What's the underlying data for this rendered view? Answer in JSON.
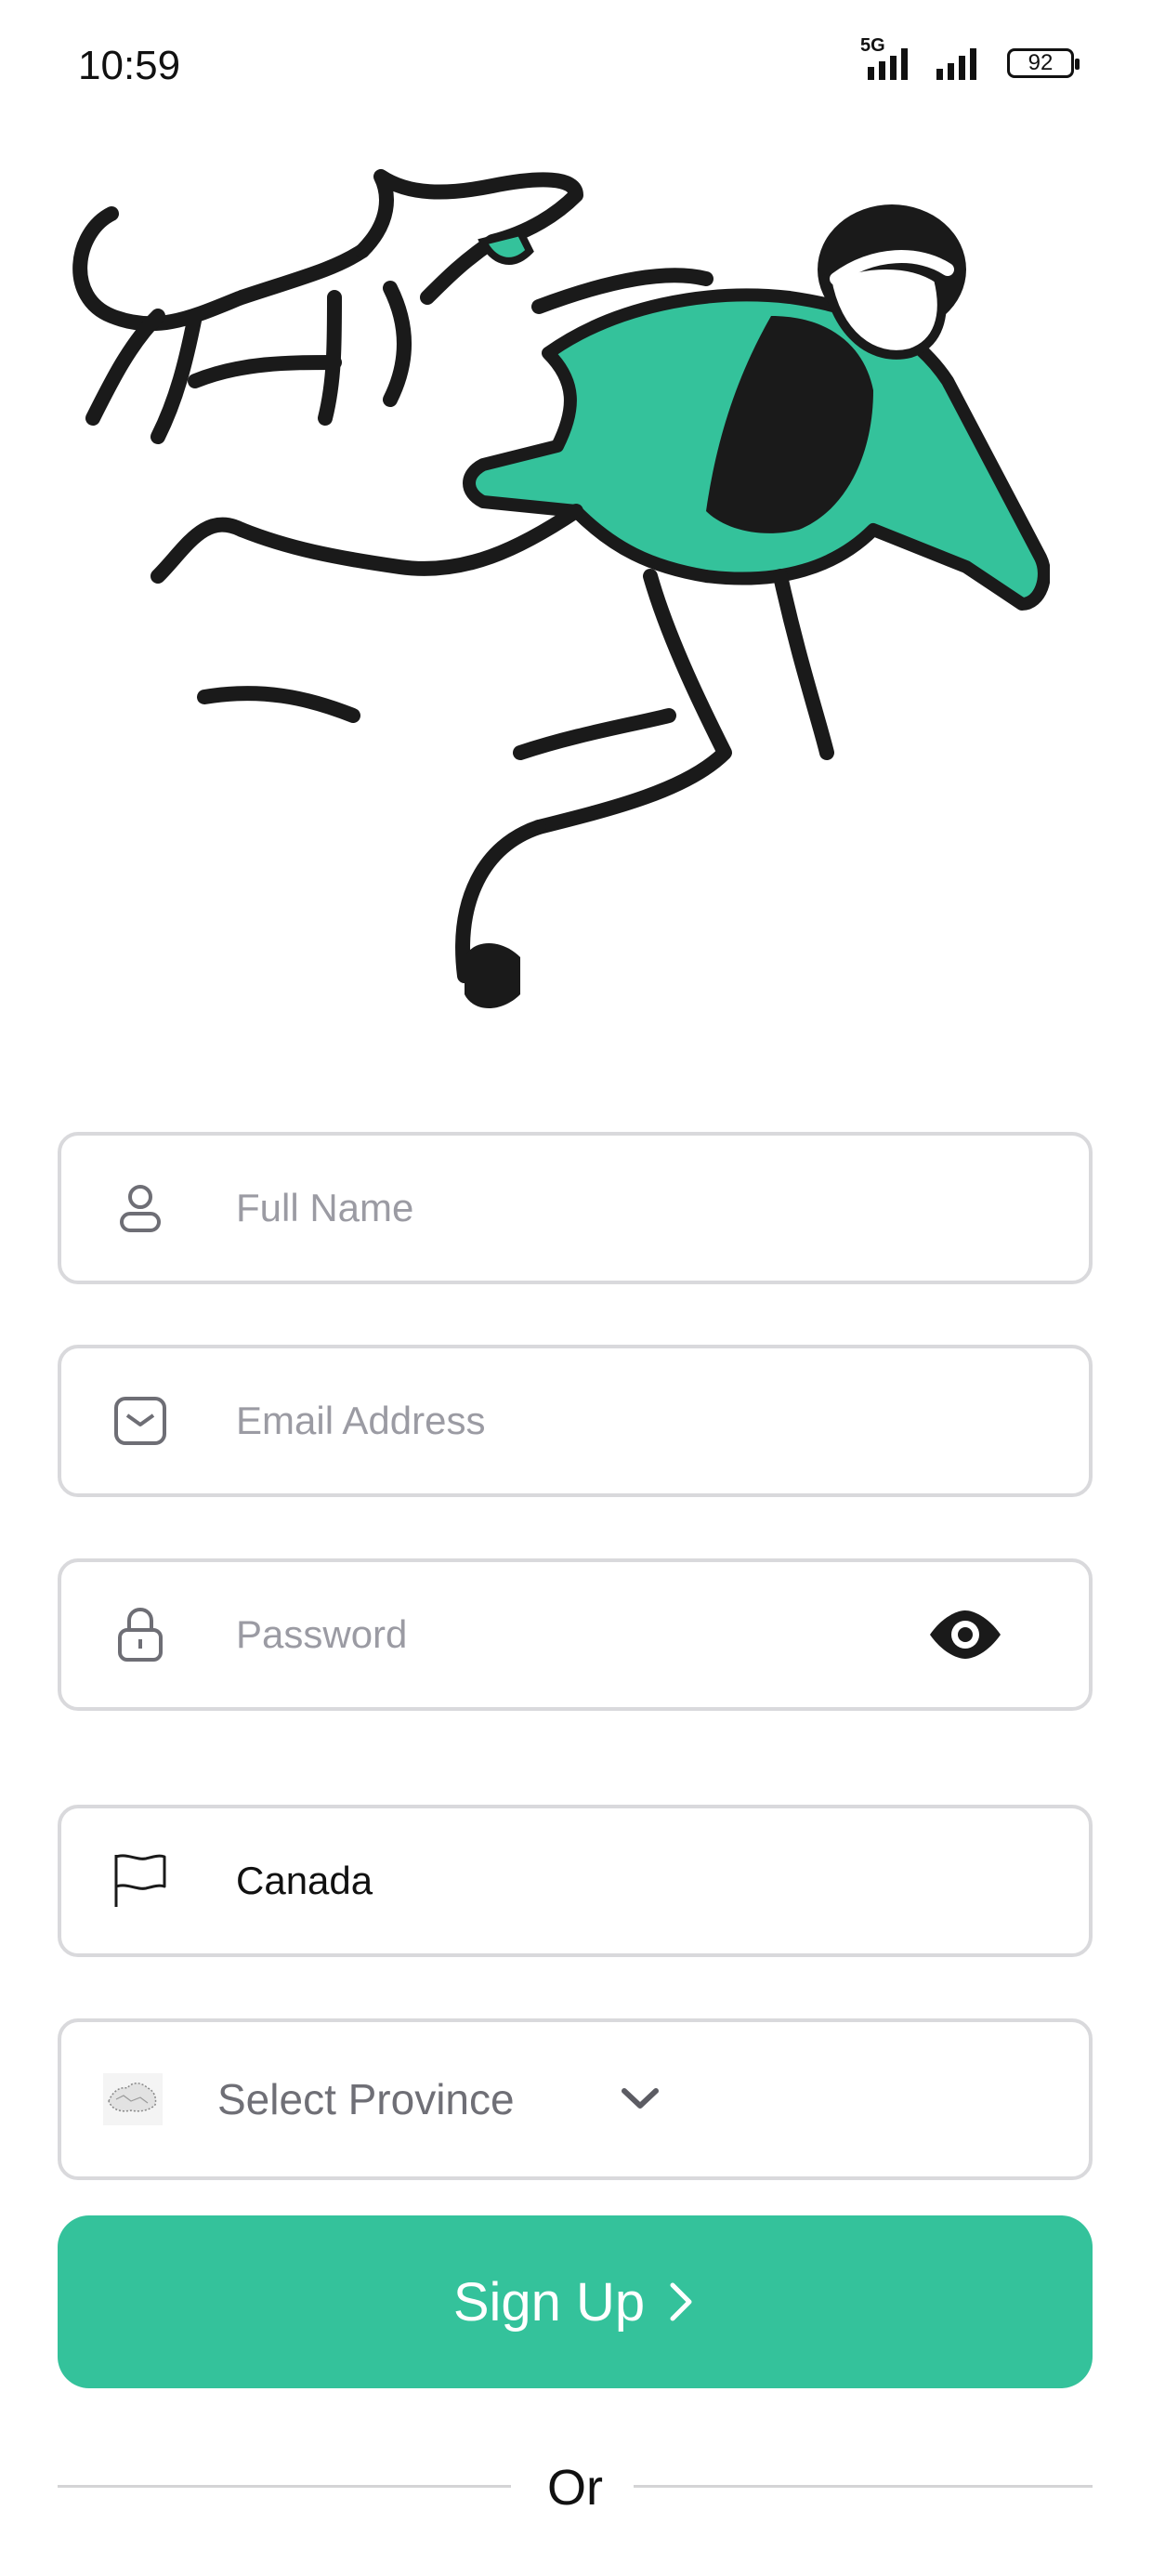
{
  "status_bar": {
    "time": "10:59",
    "network": "5G",
    "battery": "92"
  },
  "form": {
    "full_name": {
      "placeholder": "Full Name",
      "icon": "user-icon"
    },
    "email": {
      "placeholder": "Email Address",
      "icon": "mail-icon"
    },
    "password": {
      "placeholder": "Password",
      "icon": "lock-icon",
      "toggle_icon": "eye-icon"
    },
    "country": {
      "value": "Canada",
      "icon": "flag-icon"
    },
    "province": {
      "placeholder": "Select Province",
      "icon": "canada-map-icon",
      "chevron": "chevron-down-icon"
    }
  },
  "actions": {
    "signup_label": "Sign Up",
    "or_label": "Or"
  },
  "colors": {
    "accent": "#34c29b",
    "border": "#d9d9dc",
    "placeholder": "#9b9ba3"
  }
}
